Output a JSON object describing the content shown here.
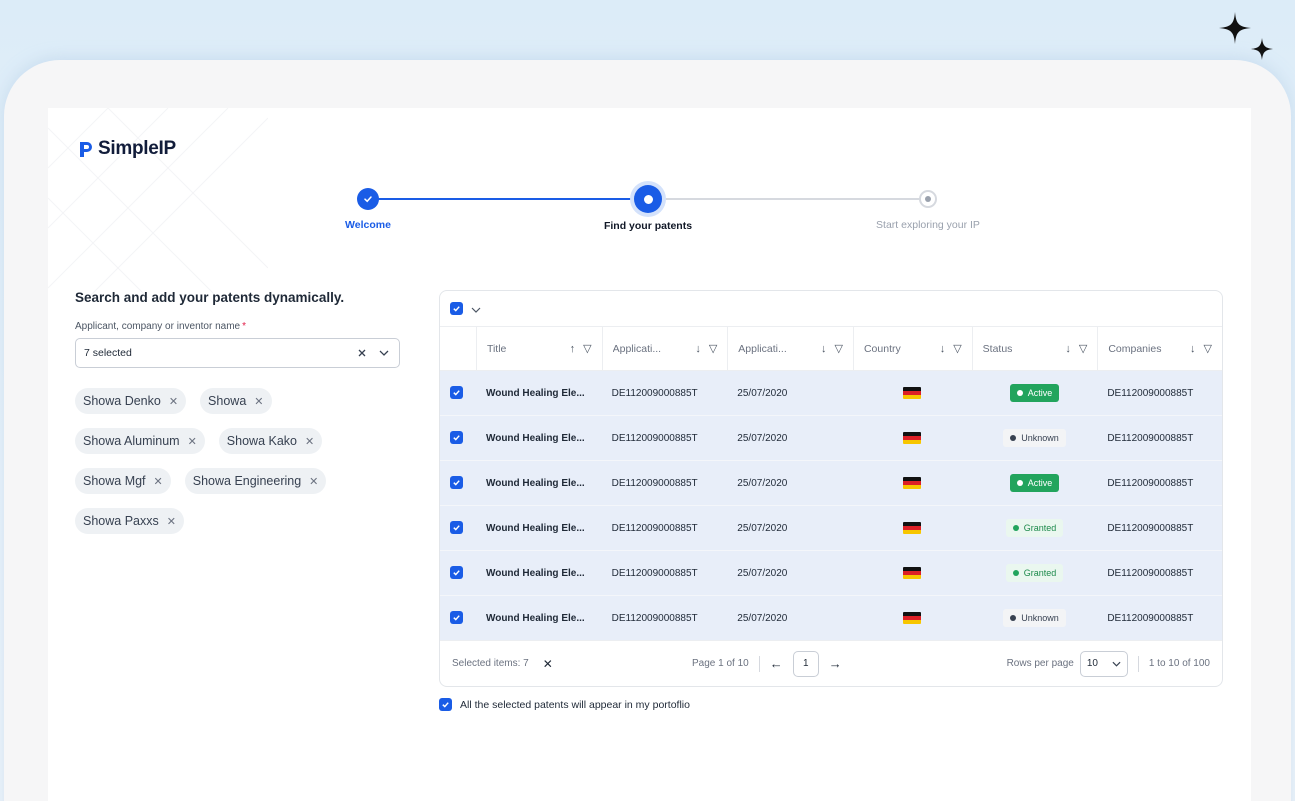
{
  "app": {
    "brand": "SimpleIP"
  },
  "stepper": {
    "steps": [
      {
        "label": "Welcome",
        "state": "done"
      },
      {
        "label": "Find your patents",
        "state": "current"
      },
      {
        "label": "Start exploring your IP",
        "state": "todo"
      }
    ]
  },
  "search": {
    "title": "Search and add your patents dynamically.",
    "field_label": "Applicant, company or inventor name",
    "required_mark": "*",
    "selected_value": "7 selected",
    "chips": [
      "Showa Denko",
      "Showa",
      "Showa Aluminum",
      "Showa Kako",
      "Showa Mgf",
      "Showa Engineering",
      "Showa Paxxs"
    ]
  },
  "table": {
    "columns": [
      {
        "label": "Title",
        "sort": "up"
      },
      {
        "label": "Applicati...",
        "sort": "down"
      },
      {
        "label": "Applicati...",
        "sort": "down"
      },
      {
        "label": "Country",
        "sort": "down"
      },
      {
        "label": "Status",
        "sort": "down"
      },
      {
        "label": "Companies",
        "sort": "down"
      }
    ],
    "rows": [
      {
        "title": "Wound Healing Ele...",
        "app_no": "DE112009000885T",
        "app_date": "25/07/2020",
        "country": "Germany flag",
        "status": "Active",
        "company": "DE112009000885T"
      },
      {
        "title": "Wound Healing Ele...",
        "app_no": "DE112009000885T",
        "app_date": "25/07/2020",
        "country": "Germany flag",
        "status": "Unknown",
        "company": "DE112009000885T"
      },
      {
        "title": "Wound Healing Ele...",
        "app_no": "DE112009000885T",
        "app_date": "25/07/2020",
        "country": "Germany flag",
        "status": "Active",
        "company": "DE112009000885T"
      },
      {
        "title": "Wound Healing Ele...",
        "app_no": "DE112009000885T",
        "app_date": "25/07/2020",
        "country": "Germany flag",
        "status": "Granted",
        "company": "DE112009000885T"
      },
      {
        "title": "Wound Healing Ele...",
        "app_no": "DE112009000885T",
        "app_date": "25/07/2020",
        "country": "Germany flag",
        "status": "Granted",
        "company": "DE112009000885T"
      },
      {
        "title": "Wound Healing Ele...",
        "app_no": "DE112009000885T",
        "app_date": "25/07/2020",
        "country": "Germany flag",
        "status": "Unknown",
        "company": "DE112009000885T"
      }
    ],
    "footer": {
      "selected_label": "Selected items: 7",
      "page_label": "Page 1 of 10",
      "current_page": "1",
      "rows_per_page_label": "Rows per page",
      "rows_per_page_value": "10",
      "range_label": "1 to 10 of 100"
    }
  },
  "portfolio_note": "All the selected patents will appear in my portoflio",
  "colors": {
    "accent": "#1a5ce6",
    "row_selected": "#e8eef9",
    "active": "#22a45d"
  }
}
